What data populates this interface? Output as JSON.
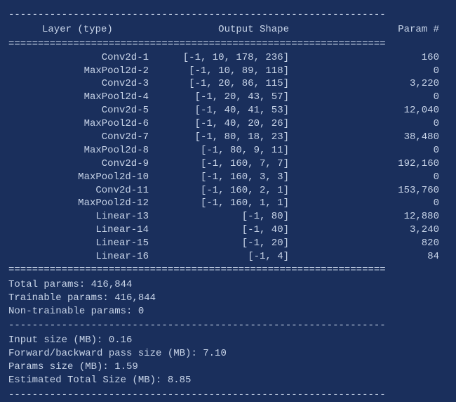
{
  "header": {
    "layer_col": "Layer (type)",
    "shape_col": "Output Shape",
    "param_col": "Param #"
  },
  "rows": [
    {
      "layer": "Conv2d-1",
      "shape": "[-1, 10, 178, 236]",
      "params": "160"
    },
    {
      "layer": "MaxPool2d-2",
      "shape": "[-1, 10, 89, 118]",
      "params": "0"
    },
    {
      "layer": "Conv2d-3",
      "shape": "[-1, 20, 86, 115]",
      "params": "3,220"
    },
    {
      "layer": "MaxPool2d-4",
      "shape": "[-1, 20, 43, 57]",
      "params": "0"
    },
    {
      "layer": "Conv2d-5",
      "shape": "[-1, 40, 41, 53]",
      "params": "12,040"
    },
    {
      "layer": "MaxPool2d-6",
      "shape": "[-1, 40, 20, 26]",
      "params": "0"
    },
    {
      "layer": "Conv2d-7",
      "shape": "[-1, 80, 18, 23]",
      "params": "38,480"
    },
    {
      "layer": "MaxPool2d-8",
      "shape": "[-1, 80, 9, 11]",
      "params": "0"
    },
    {
      "layer": "Conv2d-9",
      "shape": "[-1, 160, 7, 7]",
      "params": "192,160"
    },
    {
      "layer": "MaxPool2d-10",
      "shape": "[-1, 160, 3, 3]",
      "params": "0"
    },
    {
      "layer": "Conv2d-11",
      "shape": "[-1, 160, 2, 1]",
      "params": "153,760"
    },
    {
      "layer": "MaxPool2d-12",
      "shape": "[-1, 160, 1, 1]",
      "params": "0"
    },
    {
      "layer": "Linear-13",
      "shape": "[-1, 80]",
      "params": "12,880"
    },
    {
      "layer": "Linear-14",
      "shape": "[-1, 40]",
      "params": "3,240"
    },
    {
      "layer": "Linear-15",
      "shape": "[-1, 20]",
      "params": "820"
    },
    {
      "layer": "Linear-16",
      "shape": "[-1, 4]",
      "params": "84"
    }
  ],
  "totals": {
    "total_params": "Total params: 416,844",
    "trainable_params": "Trainable params: 416,844",
    "non_trainable_params": "Non-trainable params: 0"
  },
  "sizes": {
    "input_size": "Input size (MB): 0.16",
    "forward_backward": "Forward/backward pass size (MB): 7.10",
    "params_size": "Params size (MB): 1.59",
    "estimated_total": "Estimated Total Size (MB): 8.85"
  },
  "chart_data": {
    "type": "table",
    "title": "Model Summary",
    "columns": [
      "Layer (type)",
      "Output Shape",
      "Param #"
    ],
    "rows": [
      [
        "Conv2d-1",
        "[-1, 10, 178, 236]",
        160
      ],
      [
        "MaxPool2d-2",
        "[-1, 10, 89, 118]",
        0
      ],
      [
        "Conv2d-3",
        "[-1, 20, 86, 115]",
        3220
      ],
      [
        "MaxPool2d-4",
        "[-1, 20, 43, 57]",
        0
      ],
      [
        "Conv2d-5",
        "[-1, 40, 41, 53]",
        12040
      ],
      [
        "MaxPool2d-6",
        "[-1, 40, 20, 26]",
        0
      ],
      [
        "Conv2d-7",
        "[-1, 80, 18, 23]",
        38480
      ],
      [
        "MaxPool2d-8",
        "[-1, 80, 9, 11]",
        0
      ],
      [
        "Conv2d-9",
        "[-1, 160, 7, 7]",
        192160
      ],
      [
        "MaxPool2d-10",
        "[-1, 160, 3, 3]",
        0
      ],
      [
        "Conv2d-11",
        "[-1, 160, 2, 1]",
        153760
      ],
      [
        "MaxPool2d-12",
        "[-1, 160, 1, 1]",
        0
      ],
      [
        "Linear-13",
        "[-1, 80]",
        12880
      ],
      [
        "Linear-14",
        "[-1, 40]",
        3240
      ],
      [
        "Linear-15",
        "[-1, 20]",
        820
      ],
      [
        "Linear-16",
        "[-1, 4]",
        84
      ]
    ],
    "totals": {
      "total_params": 416844,
      "trainable_params": 416844,
      "non_trainable_params": 0
    },
    "memory_mb": {
      "input_size": 0.16,
      "forward_backward_pass": 7.1,
      "params_size": 1.59,
      "estimated_total": 8.85
    }
  }
}
